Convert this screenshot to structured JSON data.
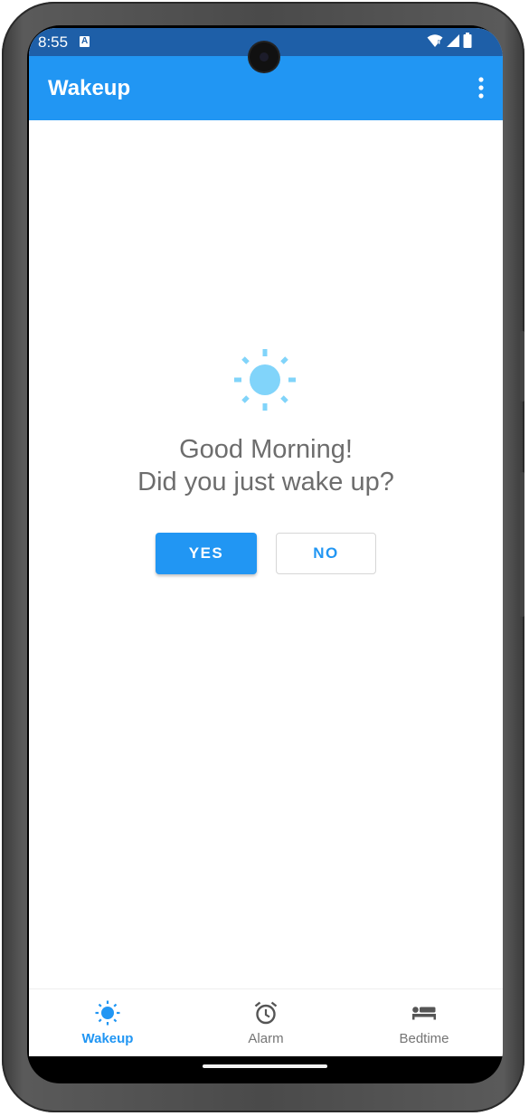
{
  "status_bar": {
    "time": "8:55",
    "icons": [
      "notification-a-icon",
      "wifi-icon",
      "signal-icon",
      "battery-icon"
    ]
  },
  "app_bar": {
    "title": "Wakeup",
    "menu_icon": "more-vert-icon"
  },
  "main": {
    "icon": "sun-icon",
    "greeting_line1": "Good Morning!",
    "greeting_line2": "Did you just wake up?",
    "yes_label": "YES",
    "no_label": "NO"
  },
  "bottom_nav": {
    "items": [
      {
        "label": "Wakeup",
        "icon": "sun-icon",
        "active": true
      },
      {
        "label": "Alarm",
        "icon": "alarm-clock-icon",
        "active": false
      },
      {
        "label": "Bedtime",
        "icon": "bed-icon",
        "active": false
      }
    ]
  },
  "colors": {
    "primary": "#2196f3",
    "status_bar": "#1e5fa8",
    "sun": "#81d4fa",
    "text_secondary": "#6d6d6d"
  }
}
